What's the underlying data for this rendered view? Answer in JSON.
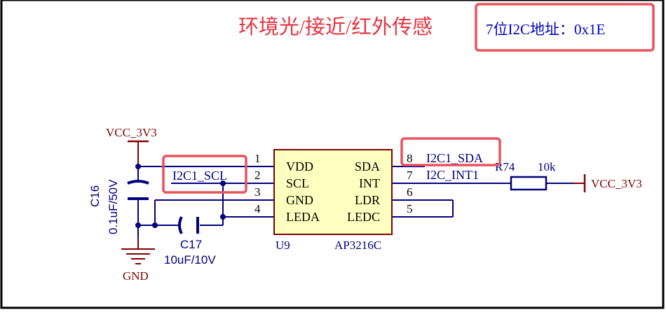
{
  "header": {
    "title": "环境光/接近/红外传感",
    "address_note": "7位I2C地址：0x1E"
  },
  "power": {
    "vcc_left": "VCC_3V3",
    "vcc_right": "VCC_3V3",
    "ground": "GND"
  },
  "capacitors": {
    "c16_ref": "C16",
    "c16_value": "0.1uF/50V",
    "c17_ref": "C17",
    "c17_value": "10uF/10V"
  },
  "chip": {
    "ref": "U9",
    "part": "AP3216C",
    "left_pins": [
      {
        "number": "1",
        "name": "VDD"
      },
      {
        "number": "2",
        "name": "SCL"
      },
      {
        "number": "3",
        "name": "GND"
      },
      {
        "number": "4",
        "name": "LEDA"
      }
    ],
    "right_pins": [
      {
        "number": "8",
        "name": "SDA"
      },
      {
        "number": "7",
        "name": "INT"
      },
      {
        "number": "6",
        "name": "LDR"
      },
      {
        "number": "5",
        "name": "LEDC"
      }
    ]
  },
  "nets": {
    "scl": "I2C1_SCL",
    "sda": "I2C1_SDA",
    "int": "I2C_INT1"
  },
  "resistor": {
    "ref": "R74",
    "value": "10k"
  },
  "colors": {
    "wire": "#00007f",
    "power": "#800000",
    "text_blue": "#0000c0",
    "highlight": "#e8535f",
    "title_red": "#e6333f"
  }
}
